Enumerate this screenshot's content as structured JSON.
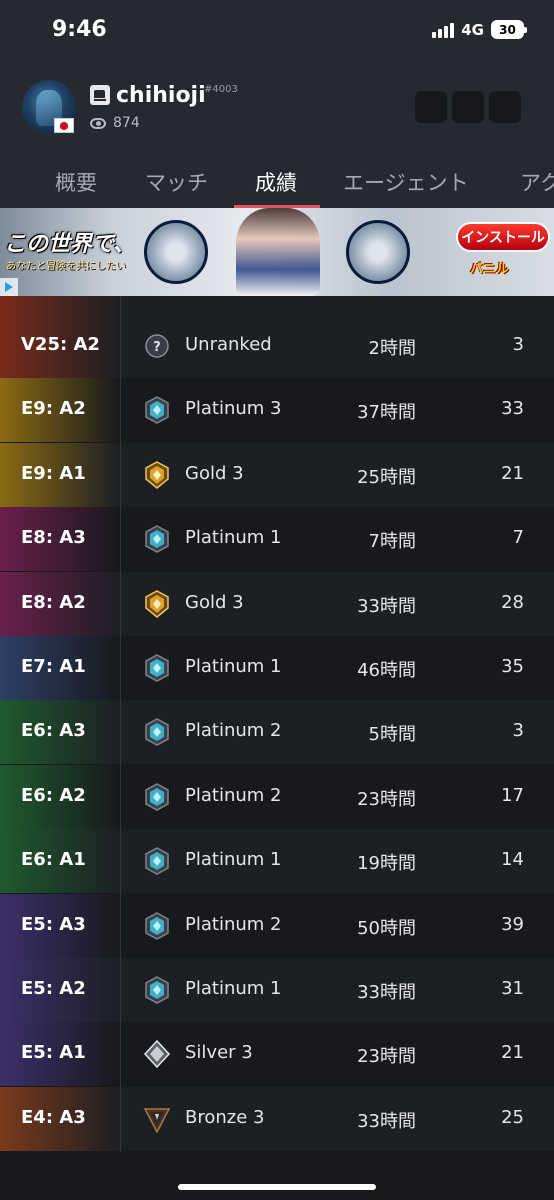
{
  "status_bar": {
    "time": "9:46",
    "network": "4G",
    "battery": "30"
  },
  "profile": {
    "username": "chihioji",
    "tag": "#4003",
    "views": "874"
  },
  "tabs": [
    {
      "label": "概要",
      "active": false
    },
    {
      "label": "マッチ",
      "active": false
    },
    {
      "label": "成績",
      "active": true
    },
    {
      "label": "エージェント",
      "active": false
    },
    {
      "label": "アク",
      "active": false
    }
  ],
  "ad": {
    "headline": "この世界で、",
    "subline": "あなたと冒険を共にしたい",
    "install_label": "インストール",
    "brand": "バニル"
  },
  "seasons": [
    {
      "season": "V25: A2",
      "rank": "Unranked",
      "icon": "unranked-icon",
      "hours": "2時間",
      "games": "3",
      "accent": "#7a2a1a"
    },
    {
      "season": "E9: A2",
      "rank": "Platinum 3",
      "icon": "platinum-icon",
      "hours": "37時間",
      "games": "33",
      "accent": "#8a6a12"
    },
    {
      "season": "E9: A1",
      "rank": "Gold 3",
      "icon": "gold-icon",
      "hours": "25時間",
      "games": "21",
      "accent": "#8a6a12"
    },
    {
      "season": "E8: A3",
      "rank": "Platinum 1",
      "icon": "platinum-icon",
      "hours": "7時間",
      "games": "7",
      "accent": "#6a1f4a"
    },
    {
      "season": "E8: A2",
      "rank": "Gold 3",
      "icon": "gold-icon",
      "hours": "33時間",
      "games": "28",
      "accent": "#6a1f4a"
    },
    {
      "season": "E7: A1",
      "rank": "Platinum 1",
      "icon": "platinum-icon",
      "hours": "46時間",
      "games": "35",
      "accent": "#2e3f66"
    },
    {
      "season": "E6: A3",
      "rank": "Platinum 2",
      "icon": "platinum-icon",
      "hours": "5時間",
      "games": "3",
      "accent": "#1f5a2e"
    },
    {
      "season": "E6: A2",
      "rank": "Platinum 2",
      "icon": "platinum-icon",
      "hours": "23時間",
      "games": "17",
      "accent": "#1f5a2e"
    },
    {
      "season": "E6: A1",
      "rank": "Platinum 1",
      "icon": "platinum-icon",
      "hours": "19時間",
      "games": "14",
      "accent": "#1f5a2e"
    },
    {
      "season": "E5: A3",
      "rank": "Platinum 2",
      "icon": "platinum-icon",
      "hours": "50時間",
      "games": "39",
      "accent": "#3c2f6a"
    },
    {
      "season": "E5: A2",
      "rank": "Platinum 1",
      "icon": "platinum-icon",
      "hours": "33時間",
      "games": "31",
      "accent": "#3c2f6a"
    },
    {
      "season": "E5: A1",
      "rank": "Silver 3",
      "icon": "silver-icon",
      "hours": "23時間",
      "games": "21",
      "accent": "#3c2f6a"
    },
    {
      "season": "E4: A3",
      "rank": "Bronze 3",
      "icon": "bronze-icon",
      "hours": "33時間",
      "games": "25",
      "accent": "#7a3a1a"
    }
  ],
  "colors": {
    "tab_underline": "#e8525c",
    "platinum": "#3fb0c8",
    "gold": "#e0a12a",
    "silver": "#c9ccd2",
    "bronze": "#a57843",
    "unranked": "#8a8d94"
  }
}
